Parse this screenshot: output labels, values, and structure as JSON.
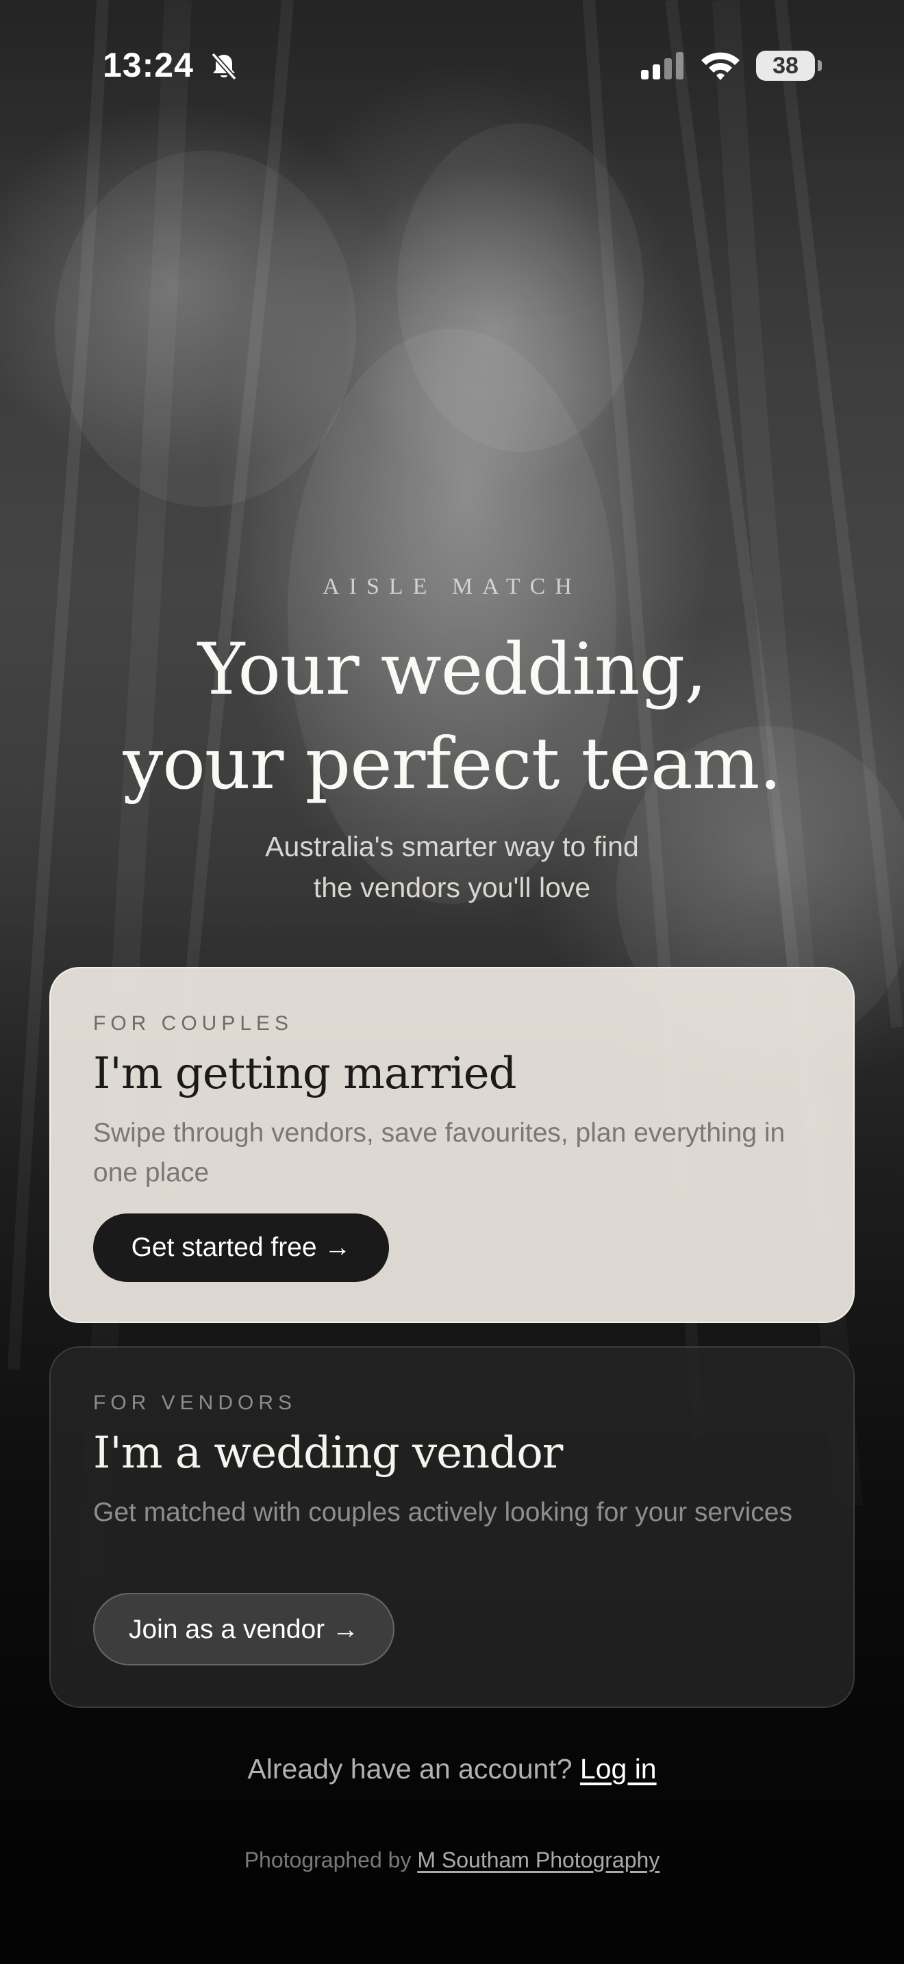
{
  "status_bar": {
    "time": "13:24",
    "silent_icon": "bell-slash-icon",
    "signal_icon": "cellular-signal-icon",
    "wifi_icon": "wifi-icon",
    "battery": "38"
  },
  "hero": {
    "brand": "AISLE MATCH",
    "headline_line1": "Your wedding,",
    "headline_line2": "your perfect team.",
    "subtitle_line1": "Australia's smarter way to find",
    "subtitle_line2": "the vendors you'll love"
  },
  "couples_card": {
    "eyebrow": "FOR COUPLES",
    "title": "I'm getting married",
    "description": "Swipe through vendors, save favourites, plan everything in one place",
    "button_label": "Get started free →"
  },
  "vendors_card": {
    "eyebrow": "FOR VENDORS",
    "title": "I'm a wedding vendor",
    "description": "Get matched with couples actively looking for your services",
    "button_label": "Join as a vendor →"
  },
  "footer": {
    "login_prompt": "Already have an account?",
    "login_link": "Log in",
    "credit_prefix": "Photographed by",
    "credit_link": "M Southam Photography"
  },
  "colors": {
    "primary_button": "#1a1a1a",
    "card_light": "#ece7e0",
    "card_dark": "#242424"
  }
}
